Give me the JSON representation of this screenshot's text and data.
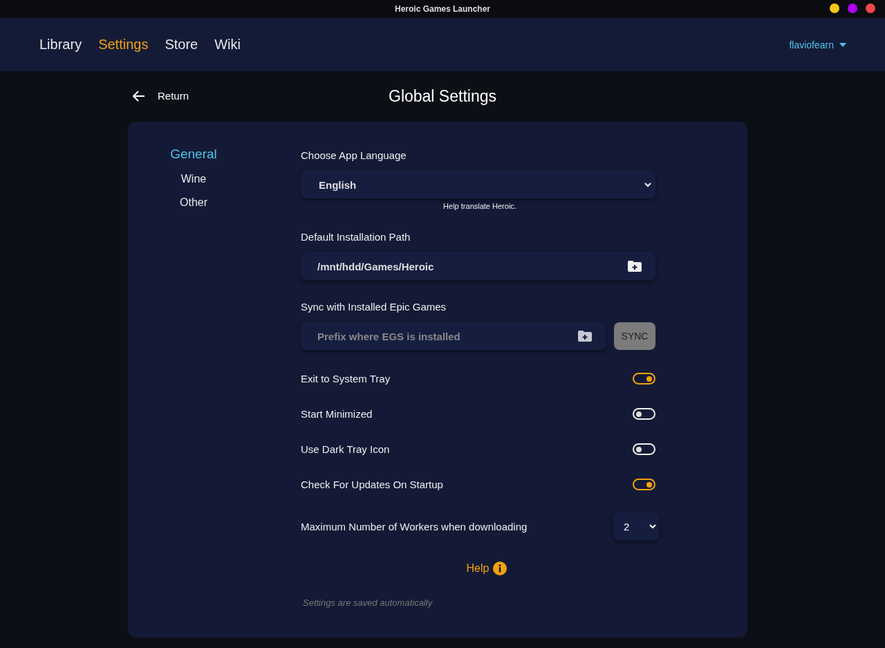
{
  "window": {
    "title": "Heroic Games Launcher"
  },
  "window_controls": [
    {
      "color": "#f5c518"
    },
    {
      "color": "#b000f0"
    },
    {
      "color": "#f04848"
    }
  ],
  "nav": [
    {
      "label": "Library",
      "selected": false
    },
    {
      "label": "Settings",
      "selected": true
    },
    {
      "label": "Store",
      "selected": false
    },
    {
      "label": "Wiki",
      "selected": false
    }
  ],
  "user": {
    "name": "flaviofearn"
  },
  "return": "Return",
  "page_title": "Global Settings",
  "sidebar": [
    {
      "label": "General",
      "selected": true
    },
    {
      "label": "Wine",
      "selected": false
    },
    {
      "label": "Other",
      "selected": false
    }
  ],
  "language": {
    "label": "Choose App Language",
    "value": "English",
    "help_link": "Help translate Heroic."
  },
  "install_path": {
    "label": "Default Installation Path",
    "value": "/mnt/hdd/Games/Heroic"
  },
  "egs_sync": {
    "label": "Sync with Installed Epic Games",
    "placeholder": "Prefix where EGS is installed",
    "button": "SYNC"
  },
  "toggles": [
    {
      "label": "Exit to System Tray",
      "on": true
    },
    {
      "label": "Start Minimized",
      "on": false
    },
    {
      "label": "Use Dark Tray Icon",
      "on": false
    },
    {
      "label": "Check For Updates On Startup",
      "on": true
    }
  ],
  "workers": {
    "label": "Maximum Number of Workers when downloading",
    "value": "2"
  },
  "help": "Help",
  "footer_note": "Settings are saved automatically"
}
